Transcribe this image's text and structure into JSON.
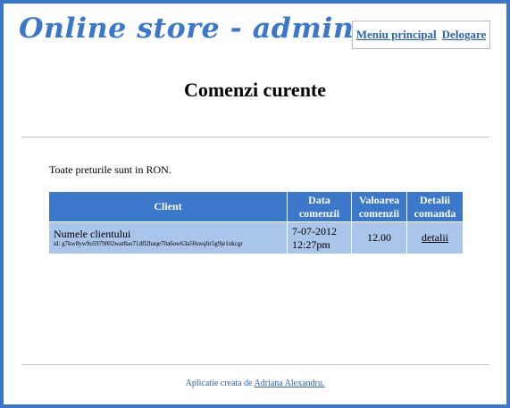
{
  "header": {
    "logo_text": "Online store - admin area",
    "nav": {
      "main_menu": "Meniu principal",
      "logout": "Delogare"
    }
  },
  "page": {
    "title": "Comenzi curente",
    "currency_note": "Toate preturile sunt in RON."
  },
  "orders_table": {
    "columns": {
      "client": "Client",
      "date": "Data comenzii",
      "value": "Valoarea comenzii",
      "details": "Detalii comanda"
    },
    "rows": [
      {
        "client_name": "Numele clientului",
        "client_id": "id: g7kw8yw9o5979002wat8ao71dfl2haqe70a6ow63a50swqlir5g9je1nkcgr",
        "date": "7-07-2012",
        "time": "12:27pm",
        "value": "12.00",
        "details_link": "detalii"
      }
    ]
  },
  "footer": {
    "prefix": "Aplicatie creata de",
    "author": "Adriana Alexandru."
  },
  "colors": {
    "brand_blue": "#3b78c9",
    "row_blue": "#aac5ea"
  }
}
